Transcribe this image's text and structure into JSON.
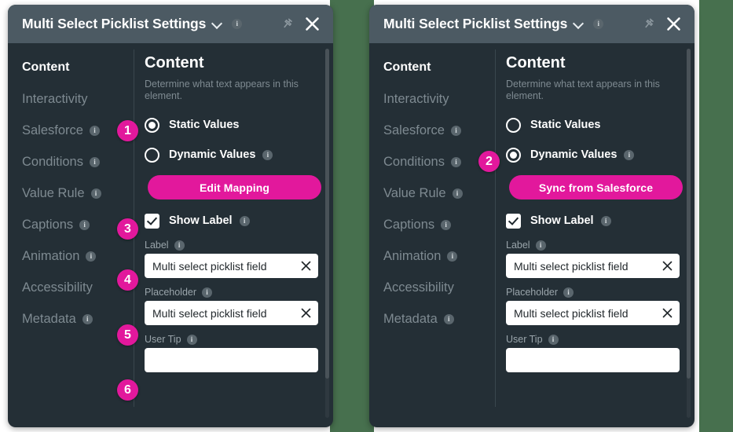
{
  "window": {
    "title": "Multi Select Picklist Settings",
    "chevron_icon": "chevron-down-icon",
    "info_icon": "info-icon",
    "pin_icon": "pin-icon",
    "close_icon": "close-icon"
  },
  "colors": {
    "accent_magenta": "#E2189C",
    "panel_background": "#242F36",
    "header_background": "#4C5A63",
    "page_background": "#47704E",
    "nav_inactive_text": "#7E8A91",
    "nav_active_text": "#FFFFFF",
    "field_background": "#FFFFFF"
  },
  "nav": {
    "items": [
      {
        "label": "Content",
        "has_info": false,
        "active": true
      },
      {
        "label": "Interactivity",
        "has_info": false,
        "active": false
      },
      {
        "label": "Salesforce",
        "has_info": true,
        "active": false
      },
      {
        "label": "Conditions",
        "has_info": true,
        "active": false
      },
      {
        "label": "Value Rule",
        "has_info": true,
        "active": false
      },
      {
        "label": "Captions",
        "has_info": true,
        "active": false
      },
      {
        "label": "Animation",
        "has_info": true,
        "active": false
      },
      {
        "label": "Accessibility",
        "has_info": false,
        "active": false
      },
      {
        "label": "Metadata",
        "has_info": true,
        "active": false
      }
    ]
  },
  "content": {
    "heading": "Content",
    "description": "Determine what text appears in this element.",
    "radio_static_label": "Static Values",
    "radio_dynamic_label": "Dynamic Values",
    "checkbox_show_label": "Show Label",
    "label_field_title": "Label",
    "label_field_value": "Multi select picklist field",
    "placeholder_field_title": "Placeholder",
    "placeholder_field_value": "Multi select picklist field",
    "usertip_field_title": "User Tip",
    "usertip_field_value": ""
  },
  "panels": {
    "left": {
      "selected_mode": "static",
      "button_label": "Edit Mapping",
      "badges": [
        "1",
        "3",
        "4",
        "5",
        "6"
      ]
    },
    "right": {
      "selected_mode": "dynamic",
      "button_label": "Sync from Salesforce",
      "badges": [
        "2"
      ]
    }
  }
}
